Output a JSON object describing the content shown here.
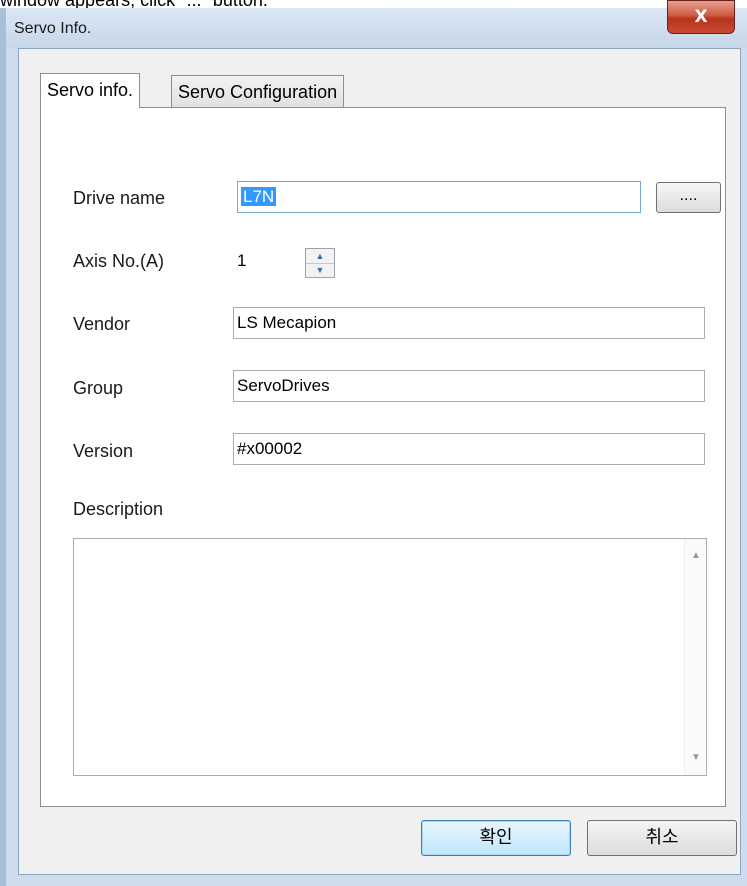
{
  "doc_snippet": "window appears, click \"...\" button.",
  "window": {
    "title": "Servo Info.",
    "close_icon": "close-icon",
    "close_label": "X"
  },
  "tabs": [
    {
      "label": "Servo info.",
      "active": true
    },
    {
      "label": "Servo Configuration",
      "active": false
    }
  ],
  "form": {
    "drive_name": {
      "label": "Drive name",
      "value": "L7N",
      "browse_label": "...."
    },
    "axis_no": {
      "label": "Axis No.(A)",
      "value": "1"
    },
    "vendor": {
      "label": "Vendor",
      "value": "LS Mecapion"
    },
    "group": {
      "label": "Group",
      "value": "ServoDrives"
    },
    "version": {
      "label": "Version",
      "value": "#x00002"
    },
    "description": {
      "label": "Description",
      "value": ""
    }
  },
  "buttons": {
    "ok_label": "확인",
    "cancel_label": "취소"
  },
  "colors": {
    "accent": "#3399ff",
    "close_button": "#c84a33",
    "window_frame": "#cfdceb"
  }
}
